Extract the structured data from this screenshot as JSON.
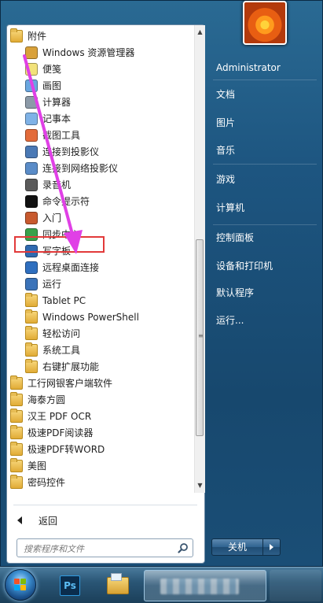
{
  "programs": {
    "items": [
      {
        "label": "附件",
        "icon": "folder-icon",
        "indent": 0
      },
      {
        "label": "Windows 资源管理器",
        "icon": "explorer-icon",
        "indent": 1
      },
      {
        "label": "便笺",
        "icon": "sticky-notes-icon",
        "indent": 1
      },
      {
        "label": "画图",
        "icon": "paint-icon",
        "indent": 1
      },
      {
        "label": "计算器",
        "icon": "calculator-icon",
        "indent": 1
      },
      {
        "label": "记事本",
        "icon": "notepad-icon",
        "indent": 1
      },
      {
        "label": "截图工具",
        "icon": "snipping-tool-icon",
        "indent": 1
      },
      {
        "label": "连接到投影仪",
        "icon": "projector-icon",
        "indent": 1
      },
      {
        "label": "连接到网络投影仪",
        "icon": "network-projector-icon",
        "indent": 1
      },
      {
        "label": "录音机",
        "icon": "microphone-icon",
        "indent": 1
      },
      {
        "label": "命令提示符",
        "icon": "command-prompt-icon",
        "indent": 1
      },
      {
        "label": "入门",
        "icon": "getting-started-icon",
        "indent": 1
      },
      {
        "label": "同步中心",
        "icon": "sync-center-icon",
        "indent": 1
      },
      {
        "label": "写字板",
        "icon": "wordpad-icon",
        "indent": 1
      },
      {
        "label": "远程桌面连接",
        "icon": "remote-desktop-icon",
        "indent": 1
      },
      {
        "label": "运行",
        "icon": "run-icon",
        "indent": 1
      },
      {
        "label": "Tablet PC",
        "icon": "folder-icon",
        "indent": 1
      },
      {
        "label": "Windows PowerShell",
        "icon": "folder-icon",
        "indent": 1
      },
      {
        "label": "轻松访问",
        "icon": "folder-icon",
        "indent": 1
      },
      {
        "label": "系统工具",
        "icon": "folder-icon",
        "indent": 1
      },
      {
        "label": "右键扩展功能",
        "icon": "folder-icon",
        "indent": 1
      },
      {
        "label": "工行网银客户端软件",
        "icon": "folder-icon",
        "indent": 0
      },
      {
        "label": "海泰方圆",
        "icon": "folder-icon",
        "indent": 0
      },
      {
        "label": "汉王 PDF OCR",
        "icon": "folder-icon",
        "indent": 0
      },
      {
        "label": "极速PDF阅读器",
        "icon": "folder-icon",
        "indent": 0
      },
      {
        "label": "极速PDF转WORD",
        "icon": "folder-icon",
        "indent": 0
      },
      {
        "label": "美图",
        "icon": "folder-icon",
        "indent": 0
      },
      {
        "label": "密码控件",
        "icon": "folder-icon",
        "indent": 0
      }
    ],
    "highlighted_item": "远程桌面连接"
  },
  "back_label": "返回",
  "search": {
    "placeholder": "搜索程序和文件"
  },
  "right_pane": {
    "items": [
      "Administrator",
      "文档",
      "图片",
      "音乐",
      "游戏",
      "计算机",
      "控制面板",
      "设备和打印机",
      "默认程序",
      "运行..."
    ]
  },
  "shutdown_label": "关机",
  "taskbar": {
    "ps_label": "Ps"
  },
  "colors": {
    "highlight": "#e23a3a",
    "annotation_arrow": "#e040e6"
  }
}
